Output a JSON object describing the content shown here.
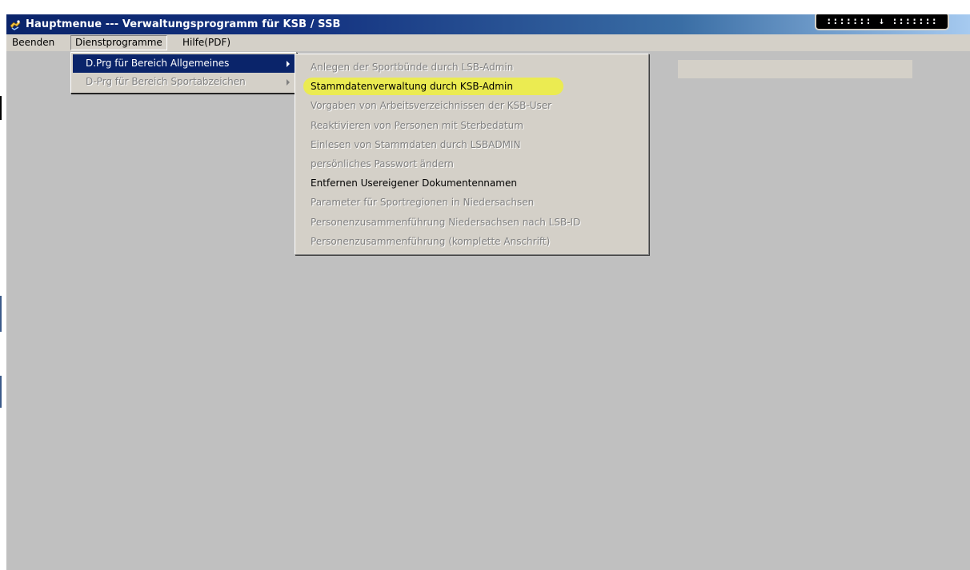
{
  "window": {
    "title": "Hauptmenue --- Verwaltungsprogramm für KSB / SSB",
    "widget_text": "::::::: ↓ :::::::",
    "icon": "app-icon"
  },
  "menubar": {
    "items": [
      {
        "label": "Beenden"
      },
      {
        "label": "Dienstprogramme",
        "open": true
      },
      {
        "label": "Hilfe(PDF)"
      }
    ]
  },
  "menu_dienstprogramme": {
    "items": [
      {
        "label": "D.Prg für Bereich Allgemeines",
        "state": "selected",
        "submenu": true
      },
      {
        "label": "D-Prg für Bereich Sportabzeichen",
        "state": "disabled",
        "submenu": true
      }
    ]
  },
  "submenu_allgemeines": {
    "items": [
      {
        "label": "Anlegen der Sportbünde durch LSB-Admin",
        "state": "disabled"
      },
      {
        "label": "Stammdatenverwaltung durch KSB-Admin",
        "state": "enabled",
        "highlighted": true
      },
      {
        "label": "Vorgaben von Arbeitsverzeichnissen der KSB-User",
        "state": "disabled"
      },
      {
        "label": "Reaktivieren von Personen mit Sterbedatum",
        "state": "disabled"
      },
      {
        "label": "Einlesen von Stammdaten durch LSBADMIN",
        "state": "disabled"
      },
      {
        "label": "persönliches Passwort ändern",
        "state": "disabled"
      },
      {
        "label": "Entfernen Usereigener Dokumentennamen",
        "state": "enabled"
      },
      {
        "label": "Parameter für Sportregionen in Niedersachsen",
        "state": "disabled"
      },
      {
        "label": "Personenzusammenführung Niedersachsen nach LSB-ID",
        "state": "disabled"
      },
      {
        "label": "Personenzusammenführung (komplette Anschrift)",
        "state": "disabled"
      }
    ]
  },
  "colors": {
    "titlebar": "#0a246a",
    "menu_face": "#d4d0c8",
    "selection": "#0a246a",
    "workspace": "#c0c0c0",
    "highlighter": "#eef03c"
  }
}
